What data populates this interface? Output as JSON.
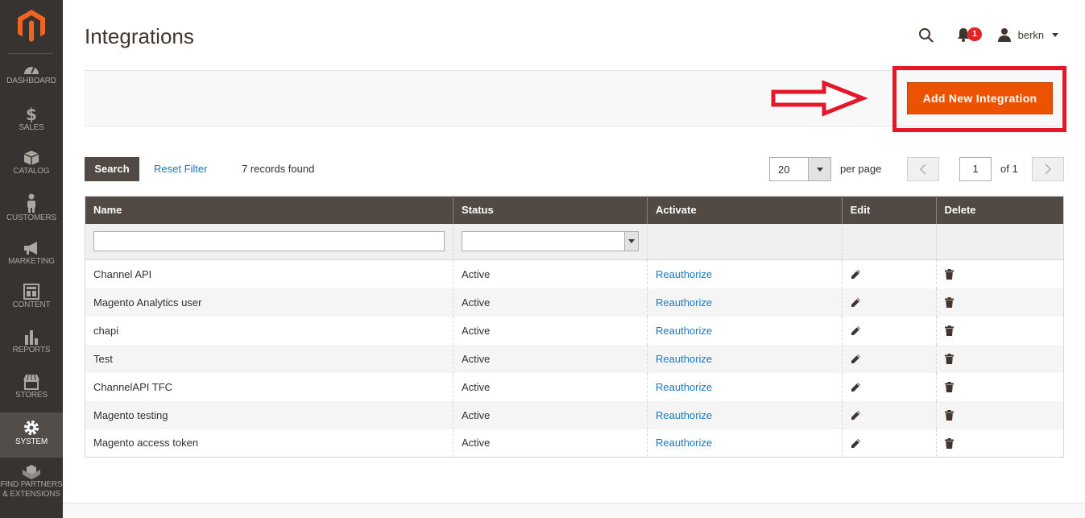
{
  "nav": {
    "items": [
      {
        "label": "DASHBOARD",
        "icon": "dashboard-icon"
      },
      {
        "label": "SALES",
        "icon": "dollar-icon"
      },
      {
        "label": "CATALOG",
        "icon": "box-icon"
      },
      {
        "label": "CUSTOMERS",
        "icon": "person-icon"
      },
      {
        "label": "MARKETING",
        "icon": "megaphone-icon"
      },
      {
        "label": "CONTENT",
        "icon": "layout-icon"
      },
      {
        "label": "REPORTS",
        "icon": "bar-chart-icon"
      },
      {
        "label": "STORES",
        "icon": "storefront-icon"
      },
      {
        "label": "SYSTEM",
        "icon": "gear-icon"
      },
      {
        "label": "FIND PARTNERS & EXTENSIONS",
        "icon": "cubes-icon"
      }
    ],
    "active": "SYSTEM"
  },
  "header": {
    "title": "Integrations",
    "notification_count": "1",
    "user_name": "berkn"
  },
  "actions": {
    "add_button": "Add New Integration"
  },
  "toolbar": {
    "search_label": "Search",
    "reset_label": "Reset Filter",
    "records_text": "7 records found",
    "per_page_value": "20",
    "per_page_label": "per page",
    "page_value": "1",
    "page_of": "of 1"
  },
  "grid": {
    "columns": [
      "Name",
      "Status",
      "Activate",
      "Edit",
      "Delete"
    ],
    "rows": [
      {
        "name": "Channel API",
        "status": "Active",
        "activate": "Reauthorize"
      },
      {
        "name": "Magento Analytics user",
        "status": "Active",
        "activate": "Reauthorize"
      },
      {
        "name": "chapi",
        "status": "Active",
        "activate": "Reauthorize"
      },
      {
        "name": "Test",
        "status": "Active",
        "activate": "Reauthorize"
      },
      {
        "name": "ChannelAPI TFC",
        "status": "Active",
        "activate": "Reauthorize"
      },
      {
        "name": "Magento testing",
        "status": "Active",
        "activate": "Reauthorize"
      },
      {
        "name": "Magento access token",
        "status": "Active",
        "activate": "Reauthorize"
      }
    ]
  },
  "colors": {
    "accent": "#eb5202",
    "sidebar": "#373330",
    "header_row": "#514943",
    "link": "#1979c3",
    "highlight": "#e4172b"
  }
}
